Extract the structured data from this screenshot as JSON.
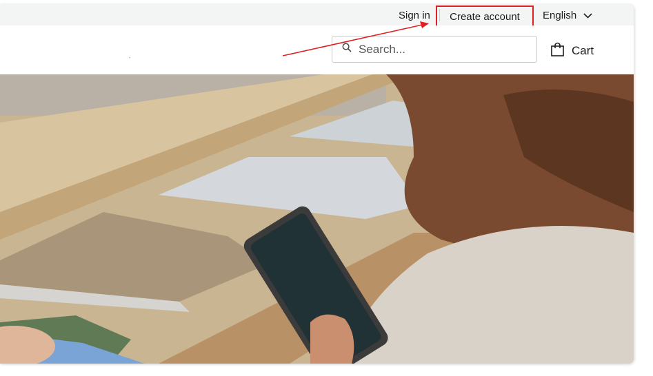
{
  "topbar": {
    "sign_in": "Sign in",
    "create_account": "Create account",
    "language": "English"
  },
  "header": {
    "search_placeholder": "Search...",
    "cart_label": "Cart"
  },
  "hero": {
    "description_icon": "hero-photo"
  },
  "colors": {
    "highlight": "#e02020",
    "topbar_bg": "#f3f4f4"
  }
}
